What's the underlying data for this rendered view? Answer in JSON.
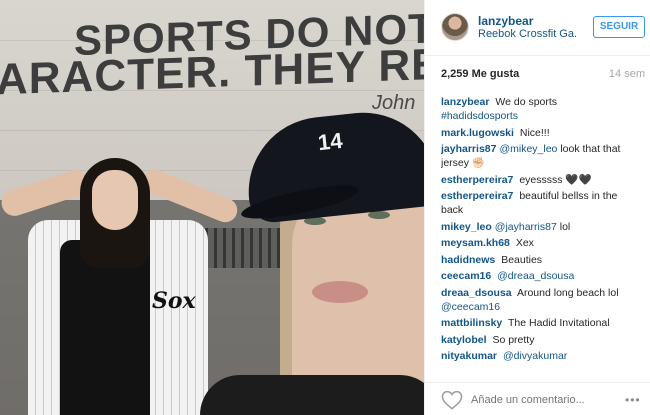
{
  "photo": {
    "wall_line1": "SPORTS DO NOT B",
    "wall_line2": "ARACTER. THEY REVEA",
    "wall_signature": "John",
    "cap_logo": "14",
    "jersey_logo": "Sox"
  },
  "header": {
    "username": "lanzybear",
    "location": "Reebok Crossfit Ga...",
    "follow_label": "SEGUIR"
  },
  "stats": {
    "likes": "2,259 Me gusta",
    "time": "14 sem"
  },
  "comments": [
    {
      "user": "lanzybear",
      "text": "We do sports",
      "tag": "#hadidsdosports"
    },
    {
      "user": "mark.lugowski",
      "text": "Nice!!!"
    },
    {
      "user": "jayharris87",
      "mention": "@mikey_leo",
      "text": " look that that jersey ✊🏻"
    },
    {
      "user": "estherpereira7",
      "text": "eyesssss 🖤🖤"
    },
    {
      "user": "estherpereira7",
      "text": "beautiful bellss in the back"
    },
    {
      "user": "mikey_leo",
      "mention": "@jayharris87",
      "text": " lol"
    },
    {
      "user": "meysam.kh68",
      "text": "Xex"
    },
    {
      "user": "hadidnews",
      "text": "Beauties"
    },
    {
      "user": "ceecam16",
      "mention": "@dreaa_dsousa",
      "text": ""
    },
    {
      "user": "dreaa_dsousa",
      "text": "Around long beach lol",
      "tag": "@ceecam16"
    },
    {
      "user": "mattbilinsky",
      "text": "The Hadid Invitational"
    },
    {
      "user": "katylobel",
      "text": "So pretty"
    },
    {
      "user": "nityakumar",
      "mention": "@divyakumar",
      "text": ""
    }
  ],
  "footer": {
    "comment_placeholder": "Añade un comentario...",
    "more_label": "•••"
  },
  "colors": {
    "link": "#125688",
    "accent": "#3897f0",
    "muted": "#a5a7aa"
  }
}
